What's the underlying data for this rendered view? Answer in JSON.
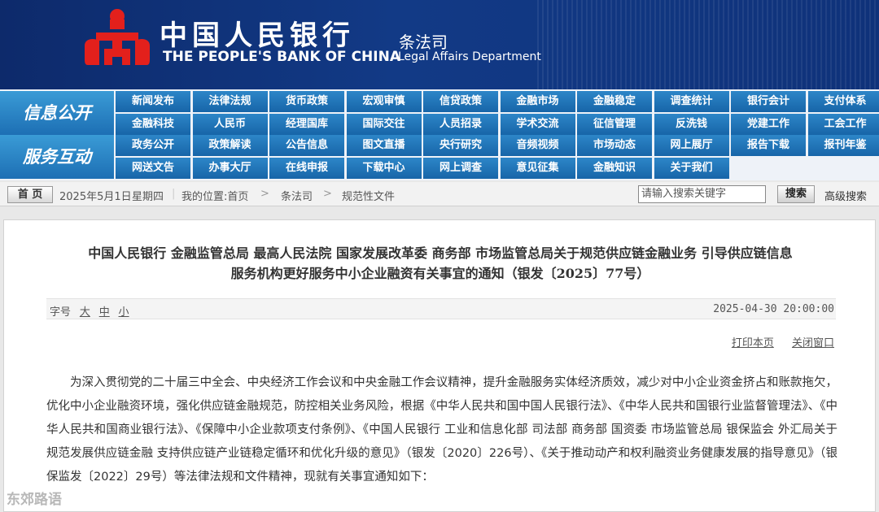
{
  "header": {
    "brand_cn": "中国人民银行",
    "brand_en": "THE PEOPLE'S BANK OF CHINA",
    "dept_cn": "条法司",
    "dept_en": "Legal Affairs Department",
    "logo_icon": "pboc-logo-icon",
    "logo_color": "#e3201c",
    "bg_color": "#123a86"
  },
  "nav": {
    "group1_label": "信息公开",
    "group2_label": "服务互动",
    "group1_rows": [
      [
        "新闻发布",
        "法律法规",
        "货币政策",
        "宏观审慎",
        "信贷政策",
        "金融市场",
        "金融稳定",
        "调查统计",
        "银行会计",
        "支付体系"
      ],
      [
        "金融科技",
        "人民币",
        "经理国库",
        "国际交往",
        "人员招录",
        "学术交流",
        "征信管理",
        "反洗钱",
        "党建工作",
        "工会工作"
      ]
    ],
    "group2_rows": [
      [
        "政务公开",
        "政策解读",
        "公告信息",
        "图文直播",
        "央行研究",
        "音频视频",
        "市场动态",
        "网上展厅",
        "报告下载",
        "报刊年鉴"
      ],
      [
        "网送文告",
        "办事大厅",
        "在线申报",
        "下载中心",
        "网上调查",
        "意见征集",
        "金融知识",
        "关于我们"
      ]
    ]
  },
  "crumb": {
    "home": "首 页",
    "date": "2025年5月1日",
    "weekday": "星期四",
    "location": "我的位置:首页",
    "sep": ">",
    "level1": "条法司",
    "level2": "规范性文件",
    "search_placeholder": "请输入搜索关键字",
    "search_button": "搜索",
    "advanced": "高级搜索"
  },
  "article": {
    "title_line1": "中国人民银行  金融监管总局  最高人民法院  国家发展改革委  商务部  市场监管总局关于规范供应链金融业务  引导供应链信息",
    "title_line2": "服务机构更好服务中小企业融资有关事宜的通知（银发〔2025〕77号）",
    "font_label": "字号",
    "font_large": "大",
    "font_medium": "中",
    "font_small": "小",
    "datetime": "2025-04-30 20:00:00",
    "print": "打印本页",
    "close": "关闭窗口",
    "paragraph": "为深入贯彻党的二十届三中全会、中央经济工作会议和中央金融工作会议精神，提升金融服务实体经济质效，减少对中小企业资金挤占和账款拖欠，优化中小企业融资环境，强化供应链金融规范，防控相关业务风险，根据《中华人民共和国中国人民银行法》、《中华人民共和国银行业监督管理法》、《中华人民共和国商业银行法》、《保障中小企业款项支付条例》、《中国人民银行 工业和信息化部 司法部 商务部 国资委 市场监管总局 银保监会 外汇局关于规范发展供应链金融 支持供应链产业链稳定循环和优化升级的意见》（银发〔2020〕226号）、《关于推动动产和权利融资业务健康发展的指导意见》（银保监发〔2022〕29号）等法律法规和文件精神，现就有关事宜通知如下："
  },
  "watermark": "东郊路语"
}
